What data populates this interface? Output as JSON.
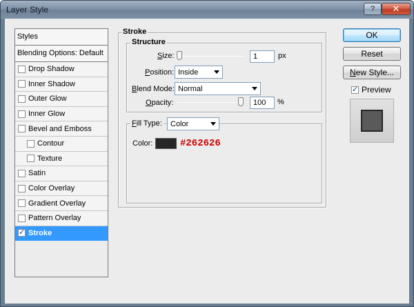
{
  "window": {
    "title": "Layer Style",
    "help_glyph": "?",
    "close_glyph": "✕"
  },
  "styles_list": {
    "header": "Styles",
    "blending_options": "Blending Options: Default",
    "items": [
      {
        "label": "Drop Shadow",
        "checked": false,
        "sub": false
      },
      {
        "label": "Inner Shadow",
        "checked": false,
        "sub": false
      },
      {
        "label": "Outer Glow",
        "checked": false,
        "sub": false
      },
      {
        "label": "Inner Glow",
        "checked": false,
        "sub": false
      },
      {
        "label": "Bevel and Emboss",
        "checked": false,
        "sub": false
      },
      {
        "label": "Contour",
        "checked": false,
        "sub": true
      },
      {
        "label": "Texture",
        "checked": false,
        "sub": true
      },
      {
        "label": "Satin",
        "checked": false,
        "sub": false
      },
      {
        "label": "Color Overlay",
        "checked": false,
        "sub": false
      },
      {
        "label": "Gradient Overlay",
        "checked": false,
        "sub": false
      },
      {
        "label": "Pattern Overlay",
        "checked": false,
        "sub": false
      },
      {
        "label": "Stroke",
        "checked": true,
        "sub": false,
        "selected": true
      }
    ]
  },
  "stroke": {
    "section_title": "Stroke",
    "structure_title": "Structure",
    "size": {
      "label_u": "S",
      "label_rest": "ize:",
      "value": "1",
      "unit": "px",
      "slider_fraction": 0.01
    },
    "position": {
      "label_u": "P",
      "label_rest": "osition:",
      "value": "Inside"
    },
    "blend_mode": {
      "label_u": "B",
      "label_mid": "lend Mode",
      "label_end": ":",
      "value": "Normal"
    },
    "opacity": {
      "label_u": "O",
      "label_rest": "pacity:",
      "value": "100",
      "unit": "%",
      "slider_fraction": 1.0
    },
    "fill_type": {
      "label_u": "F",
      "label_rest": "ill Type:",
      "value": "Color"
    },
    "color": {
      "label": "Color:",
      "hex_label": "#262626",
      "swatch": "#262626",
      "hex_text_color": "#cc0000"
    }
  },
  "buttons": {
    "ok": "OK",
    "reset": "Reset",
    "new_style_u": "N",
    "new_style_rest": "ew Style...",
    "preview_label": "Preview",
    "preview_checked": true
  }
}
